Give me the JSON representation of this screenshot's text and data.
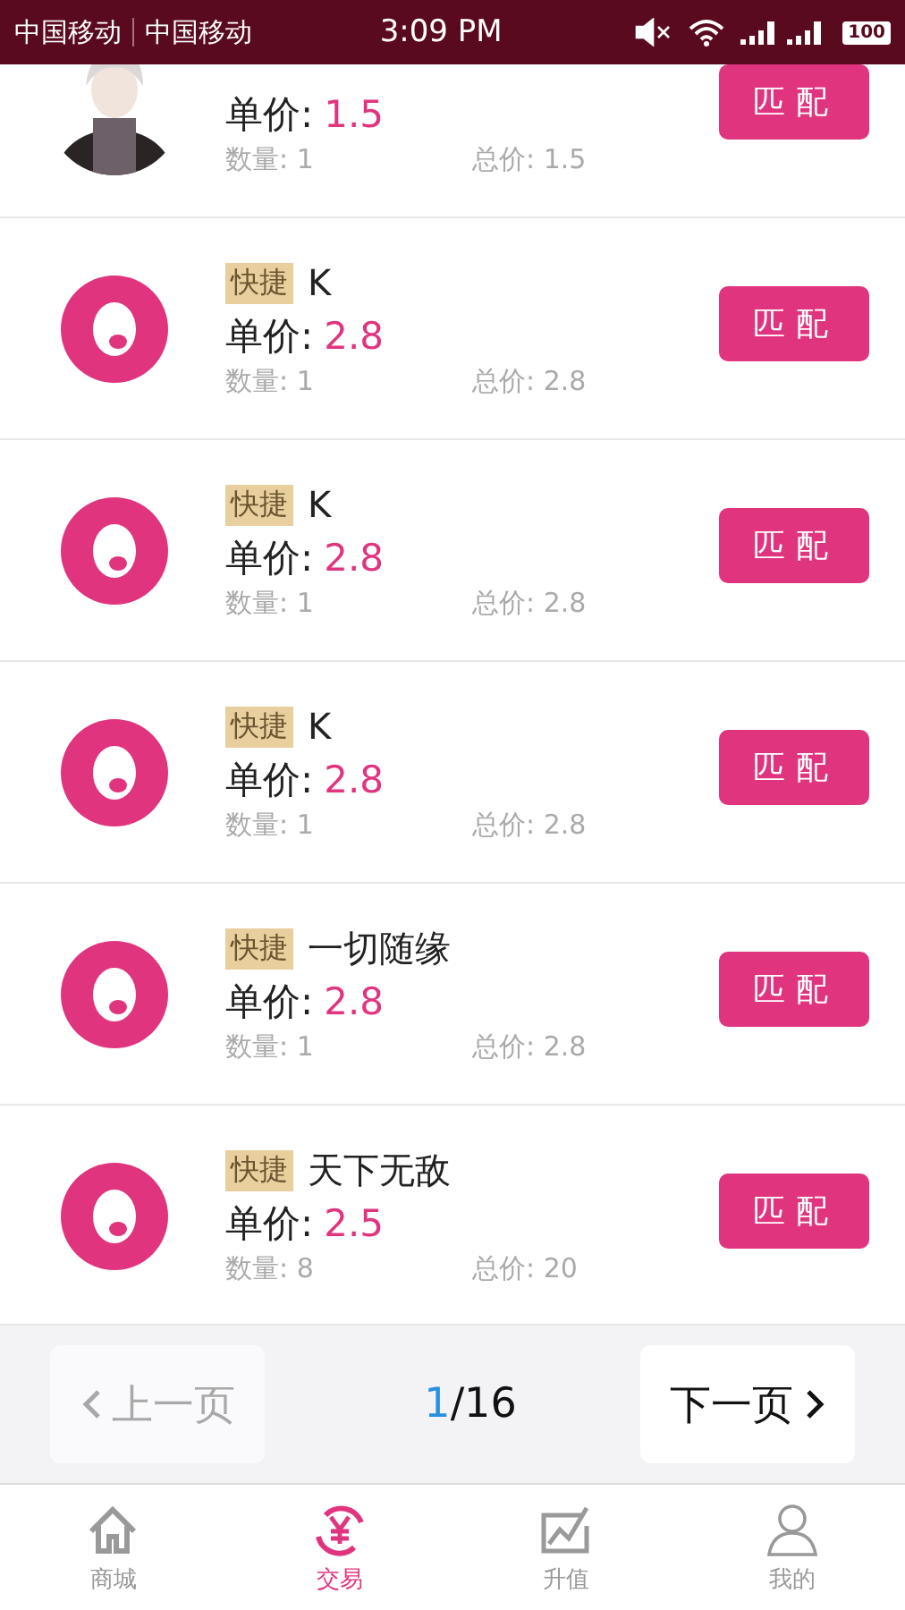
{
  "status_bar": {
    "carrier_1": "中国移动",
    "carrier_2": "中国移动",
    "time": "3:09 PM",
    "battery": "100"
  },
  "orders": [
    {
      "kind": "picture",
      "price_label": "单价:",
      "price": "1.5",
      "quantity": "数量: 1",
      "total": "总价: 1.5",
      "button": "匹配"
    },
    {
      "kind": "logo",
      "tag": "快捷",
      "name": "K",
      "price_label": "单价:",
      "price": "2.8",
      "quantity": "数量: 1",
      "total": "总价: 2.8",
      "button": "匹配"
    },
    {
      "kind": "logo",
      "tag": "快捷",
      "name": "K",
      "price_label": "单价:",
      "price": "2.8",
      "quantity": "数量: 1",
      "total": "总价: 2.8",
      "button": "匹配"
    },
    {
      "kind": "logo",
      "tag": "快捷",
      "name": "K",
      "price_label": "单价:",
      "price": "2.8",
      "quantity": "数量: 1",
      "total": "总价: 2.8",
      "button": "匹配"
    },
    {
      "kind": "logo",
      "tag": "快捷",
      "name": "一切随缘",
      "price_label": "单价:",
      "price": "2.8",
      "quantity": "数量: 1",
      "total": "总价: 2.8",
      "button": "匹配"
    },
    {
      "kind": "logo",
      "tag": "快捷",
      "name": "天下无敌",
      "price_label": "单价:",
      "price": "2.5",
      "quantity": "数量: 8",
      "total": "总价: 20",
      "button": "匹配"
    }
  ],
  "pager": {
    "prev": {
      "label": "上一页",
      "disabled": true
    },
    "current": "1",
    "rest": "/16",
    "next": {
      "label": "下一页",
      "disabled": false
    }
  },
  "tabs": [
    {
      "label": "商城",
      "selected": false
    },
    {
      "label": "交易",
      "selected": true
    },
    {
      "label": "升值",
      "selected": false
    },
    {
      "label": "我的",
      "selected": false
    }
  ]
}
